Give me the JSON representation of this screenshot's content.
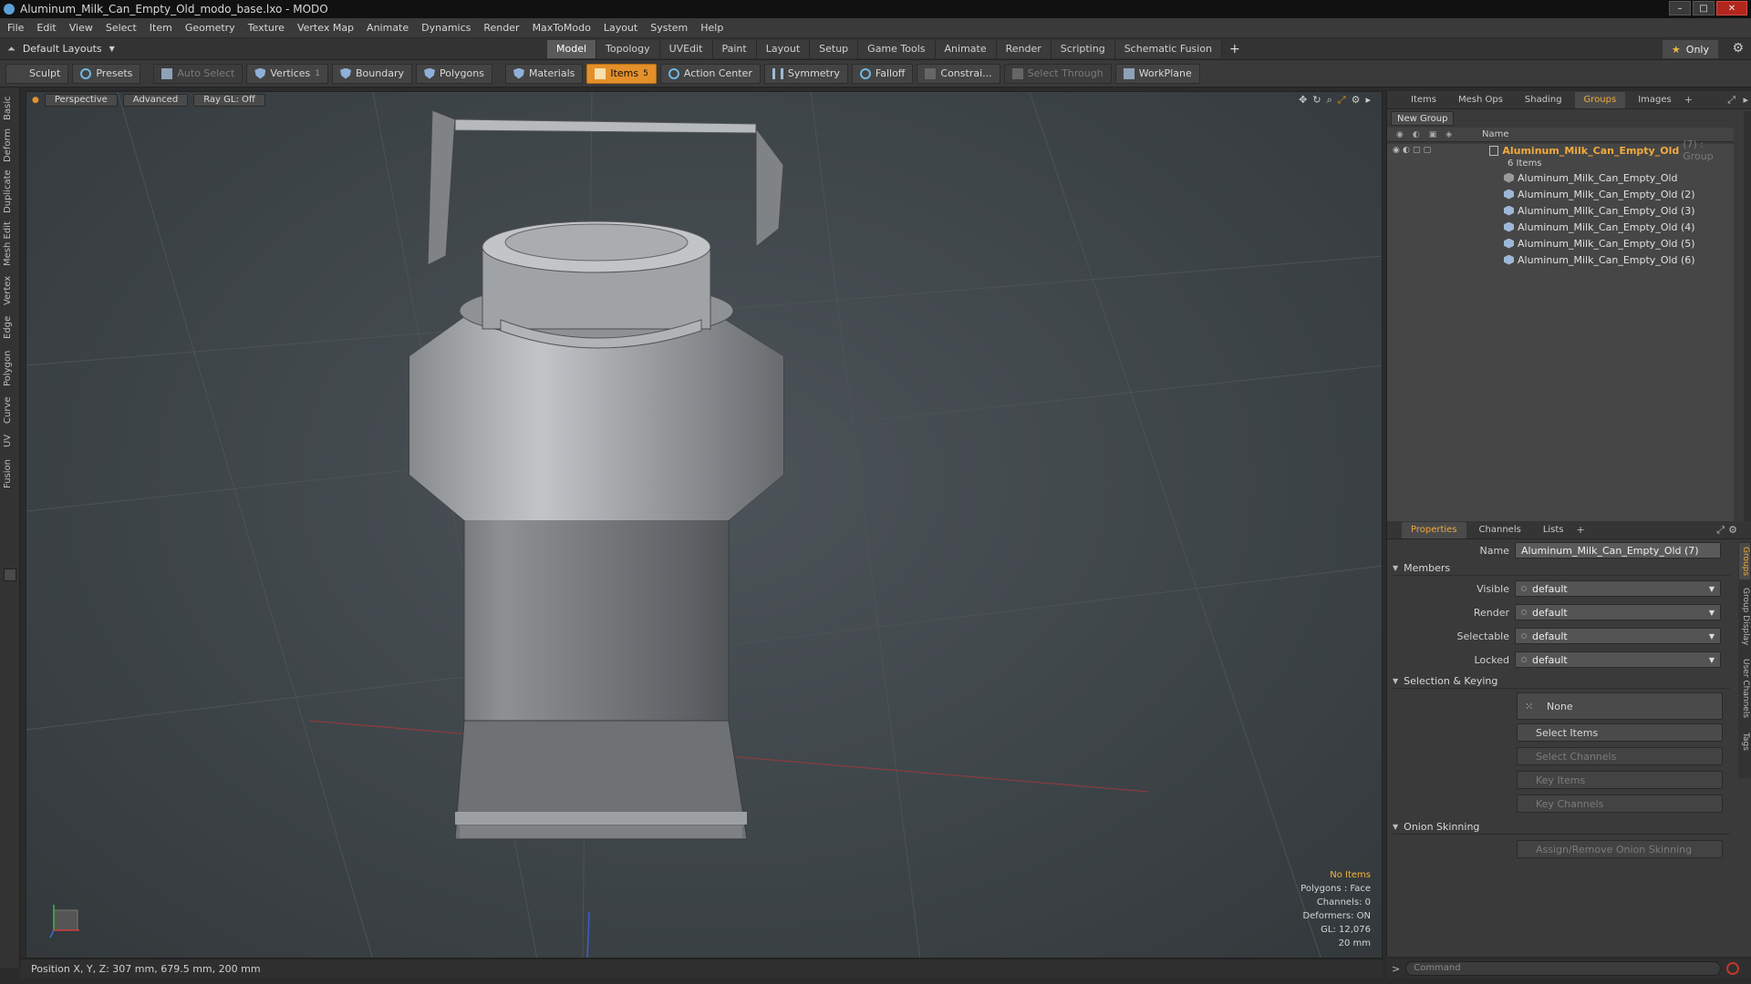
{
  "window": {
    "title": "Aluminum_Milk_Can_Empty_Old_modo_base.lxo - MODO",
    "controls": [
      "–",
      "□",
      "✕"
    ]
  },
  "menu": [
    "File",
    "Edit",
    "View",
    "Select",
    "Item",
    "Geometry",
    "Texture",
    "Vertex Map",
    "Animate",
    "Dynamics",
    "Render",
    "MaxToModo",
    "Layout",
    "System",
    "Help"
  ],
  "layouts": {
    "label": "Default Layouts",
    "tabs": [
      "Model",
      "Topology",
      "UVEdit",
      "Paint",
      "Layout",
      "Setup",
      "Game Tools",
      "Animate",
      "Render",
      "Scripting",
      "Schematic Fusion"
    ],
    "active": "Model",
    "only_label": "Only"
  },
  "toolbar": {
    "sculpt": "Sculpt",
    "presets": "Presets",
    "auto_select": "Auto Select",
    "vertices": "Vertices",
    "boundary": "Boundary",
    "polygons": "Polygons",
    "materials": "Materials",
    "items": "Items",
    "action_center": "Action Center",
    "symmetry": "Symmetry",
    "falloff": "Falloff",
    "constraint": "Constrai...",
    "select_through": "Select Through",
    "workplane": "WorkPlane",
    "vertices_count": "1",
    "items_count": "5"
  },
  "left_tabs": [
    "Basic",
    "Deform",
    "Duplicate",
    "Mesh Edit",
    "Vertex",
    "Edge",
    "Polygon",
    "Curve",
    "UV",
    "Fusion"
  ],
  "viewport": {
    "view": "Perspective",
    "shading": "Advanced",
    "raygl": "Ray GL: Off",
    "info": {
      "no_items": "No Items",
      "polygons": "Polygons : Face",
      "channels": "Channels: 0",
      "deformers": "Deformers: ON",
      "gl": "GL: 12,076",
      "scale": "20 mm"
    }
  },
  "status": {
    "position": "Position X, Y, Z:  307 mm, 679.5 mm, 200 mm",
    "command_placeholder": "Command"
  },
  "outliner": {
    "tabs": [
      "Items",
      "Mesh Ops",
      "Shading",
      "Groups",
      "Images"
    ],
    "active": "Groups",
    "new_group": "New Group",
    "name_header": "Name",
    "group": {
      "name": "Aluminum_Milk_Can_Empty_Old",
      "suffix": "(7) : Group",
      "count": "6 Items"
    },
    "items": [
      "Aluminum_Milk_Can_Empty_Old",
      "Aluminum_Milk_Can_Empty_Old (2)",
      "Aluminum_Milk_Can_Empty_Old (3)",
      "Aluminum_Milk_Can_Empty_Old (4)",
      "Aluminum_Milk_Can_Empty_Old (5)",
      "Aluminum_Milk_Can_Empty_Old (6)"
    ]
  },
  "properties": {
    "tabs": [
      "Properties",
      "Channels",
      "Lists"
    ],
    "active": "Properties",
    "name_label": "Name",
    "name_value": "Aluminum_Milk_Can_Empty_Old (7)",
    "members": "Members",
    "visible_label": "Visible",
    "visible": "default",
    "render_label": "Render",
    "render": "default",
    "selectable_label": "Selectable",
    "selectable": "default",
    "locked_label": "Locked",
    "locked": "default",
    "selection_keying": "Selection & Keying",
    "none": "None",
    "select_items": "Select Items",
    "select_channels": "Select Channels",
    "key_items": "Key Items",
    "key_channels": "Key Channels",
    "onion": "Onion Skinning",
    "onion_btn": "Assign/Remove Onion Skinning",
    "side_tabs": [
      "Groups",
      "Group Display",
      "User Channels",
      "Tags"
    ]
  },
  "colors": {
    "accent": "#e3902a",
    "group_text": "#f2a93c",
    "viewport_bg": "#3e4549"
  }
}
